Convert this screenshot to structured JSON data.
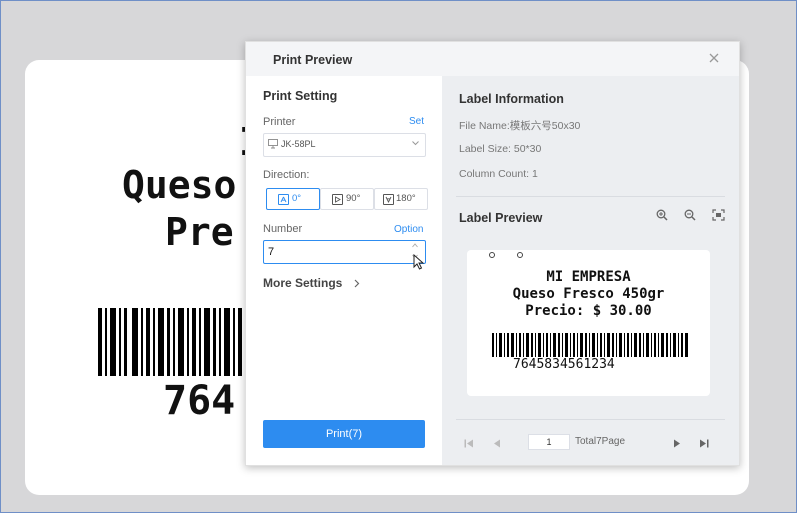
{
  "background": {
    "line1": "I",
    "line2": "Queso",
    "line3": "Pre",
    "barcode_number": "764"
  },
  "dialog": {
    "title": "Print Preview",
    "print_setting": {
      "title": "Print Setting",
      "printer_label": "Printer",
      "printer_set_link": "Set",
      "printer_value": "JK-58PL",
      "direction_label": "Direction:",
      "directions": [
        "0°",
        "90°",
        "180°"
      ],
      "selected_direction": "0°",
      "number_label": "Number",
      "number_option_link": "Option",
      "number_value": "7",
      "more_settings": "More Settings",
      "print_button": "Print(7)"
    },
    "label_information": {
      "title": "Label Information",
      "file_name": "File Name:模板六号50x30",
      "label_size": "Label Size: 50*30",
      "column_count": "Column Count: 1"
    },
    "label_preview": {
      "title": "Label Preview",
      "line1": "MI EMPRESA",
      "line2": "Queso Fresco 450gr",
      "line3": "Precio: $ 30.00",
      "barcode_number": "7645834561234"
    },
    "pager": {
      "current_page": "1",
      "total": "Total7Page"
    }
  },
  "colors": {
    "accent": "#2d8cf0",
    "panel_right": "#eceef1"
  }
}
